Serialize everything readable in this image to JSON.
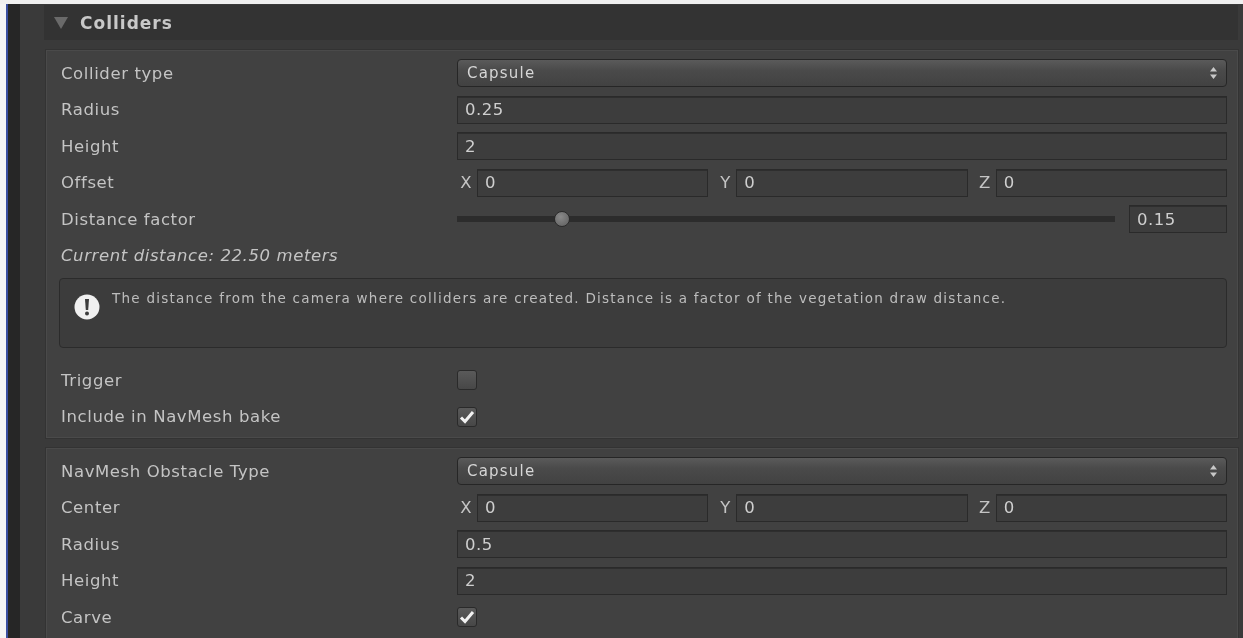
{
  "section": {
    "title": "Colliders",
    "expanded": true
  },
  "groups": [
    {
      "rows": [
        {
          "kind": "dropdown",
          "label": "Collider type",
          "value": "Capsule"
        },
        {
          "kind": "field",
          "label": "Radius",
          "value": "0.25"
        },
        {
          "kind": "field",
          "label": "Height",
          "value": "2"
        },
        {
          "kind": "vector3",
          "label": "Offset",
          "components": [
            {
              "axis": "X",
              "value": "0"
            },
            {
              "axis": "Y",
              "value": "0"
            },
            {
              "axis": "Z",
              "value": "0"
            }
          ]
        },
        {
          "kind": "slider",
          "label": "Distance factor",
          "level": 0.16,
          "value": "0.15"
        },
        {
          "kind": "note",
          "text": "Current distance: 22.50 meters"
        },
        {
          "kind": "help",
          "text": "The distance from the camera where colliders are created. Distance is a factor of the vegetation draw distance."
        },
        {
          "kind": "checkbox",
          "label": "Trigger",
          "checked": false
        },
        {
          "kind": "checkbox",
          "label": "Include in NavMesh bake",
          "checked": true
        }
      ]
    },
    {
      "rows": [
        {
          "kind": "dropdown",
          "label": "NavMesh Obstacle Type",
          "value": "Capsule"
        },
        {
          "kind": "vector3",
          "label": "Center",
          "components": [
            {
              "axis": "X",
              "value": "0"
            },
            {
              "axis": "Y",
              "value": "0"
            },
            {
              "axis": "Z",
              "value": "0"
            }
          ]
        },
        {
          "kind": "field",
          "label": "Radius",
          "value": "0.5"
        },
        {
          "kind": "field",
          "label": "Height",
          "value": "2"
        },
        {
          "kind": "checkbox",
          "label": "Carve",
          "checked": true
        }
      ]
    }
  ]
}
